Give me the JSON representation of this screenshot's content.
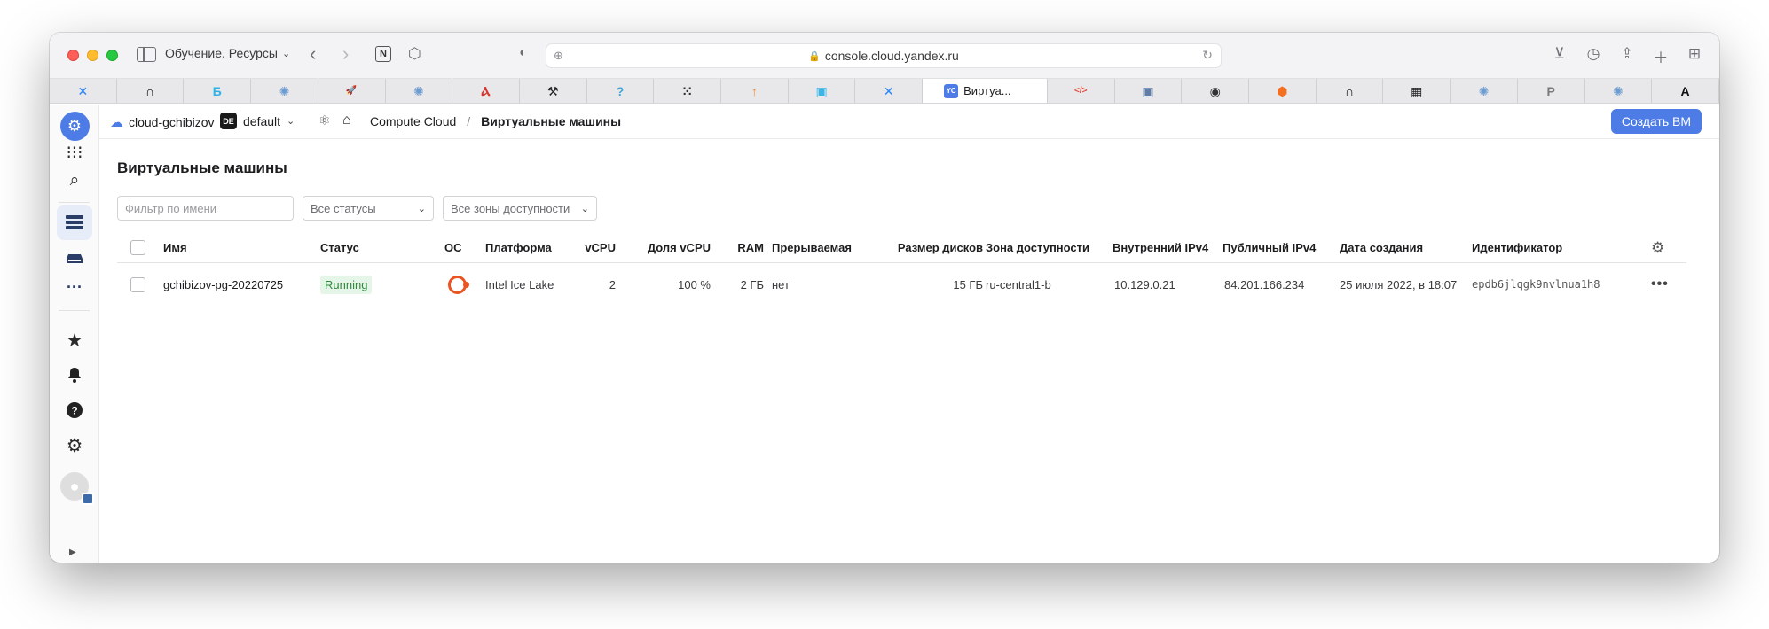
{
  "browser": {
    "tab_group_label": "Обучение. Ресурсы",
    "url": "console.cloud.yandex.ru",
    "active_tab_label": "Виртуа...",
    "active_tab_badge": "YC",
    "tabs": [
      {
        "icon": "confluence-icon",
        "glyph": "✕",
        "color": "#2684ff"
      },
      {
        "icon": "black-square-icon",
        "glyph": "∩",
        "color": "#111111"
      },
      {
        "icon": "gitbook-icon",
        "glyph": "Ƃ",
        "color": "#2cb3e8"
      },
      {
        "icon": "dot-icon",
        "glyph": "✺",
        "color": "#6a9bd1"
      },
      {
        "icon": "rocket-icon",
        "glyph": "🚀",
        "color": "#333333"
      },
      {
        "icon": "dot-icon",
        "glyph": "✺",
        "color": "#6a9bd1"
      },
      {
        "icon": "antenna-icon",
        "glyph": "Ⲁ",
        "color": "#d9342b"
      },
      {
        "icon": "drill-icon",
        "glyph": "⚒",
        "color": "#222222"
      },
      {
        "icon": "question-icon",
        "glyph": "?",
        "color": "#3fa7d6"
      },
      {
        "icon": "grid-dots-icon",
        "glyph": "⁙",
        "color": "#333333"
      },
      {
        "icon": "arrow-up-icon",
        "glyph": "↑",
        "color": "#f28a20"
      },
      {
        "icon": "robot-icon",
        "glyph": "▣",
        "color": "#38b7e8"
      },
      {
        "icon": "confluence-icon",
        "glyph": "✕",
        "color": "#2684ff"
      },
      {
        "icon": "active",
        "glyph": "",
        "color": ""
      },
      {
        "icon": "code-icon",
        "glyph": "</>",
        "color": "#e04a3c"
      },
      {
        "icon": "chip-icon",
        "glyph": "▣",
        "color": "#5f7da6"
      },
      {
        "icon": "disk-icon",
        "glyph": "◉",
        "color": "#333333"
      },
      {
        "icon": "hexagon-icon",
        "glyph": "⬢",
        "color": "#f37021"
      },
      {
        "icon": "black-square-icon",
        "glyph": "∩",
        "color": "#111111"
      },
      {
        "icon": "qr-icon",
        "glyph": "▦",
        "color": "#222222"
      },
      {
        "icon": "dot-icon",
        "glyph": "✺",
        "color": "#6a9bd1"
      },
      {
        "icon": "p-icon",
        "glyph": "P",
        "color": "#7a7a7a"
      },
      {
        "icon": "dot-icon",
        "glyph": "✺",
        "color": "#6a9bd1"
      },
      {
        "icon": "a-circle-icon",
        "glyph": "A",
        "color": "#111111"
      }
    ]
  },
  "header": {
    "cloud": "cloud-gchibizov",
    "folder_badge": "DE",
    "folder": "default",
    "service": "Compute Cloud",
    "separator": "/",
    "current": "Виртуальные машины",
    "create_button": "Создать ВМ"
  },
  "page": {
    "title": "Виртуальные машины",
    "filter_placeholder": "Фильтр по имени",
    "status_filter": "Все статусы",
    "zone_filter": "Все зоны доступности"
  },
  "table": {
    "columns": {
      "name": "Имя",
      "status": "Статус",
      "os": "ОС",
      "platform": "Платформа",
      "vcpu": "vCPU",
      "vcpu_share": "Доля vCPU",
      "ram": "RAM",
      "preemptible": "Прерываемая",
      "disk_size": "Размер дисков",
      "zone": "Зона доступности",
      "internal_ip": "Внутренний IPv4",
      "public_ip": "Публичный IPv4",
      "created": "Дата создания",
      "id": "Идентификатор"
    },
    "rows": [
      {
        "name": "gchibizov-pg-20220725",
        "status": "Running",
        "os": "ubuntu-icon",
        "platform": "Intel Ice Lake",
        "vcpu": "2",
        "vcpu_share": "100 %",
        "ram": "2 ГБ",
        "preemptible": "нет",
        "disk_size": "15 ГБ",
        "zone": "ru-central1-b",
        "internal_ip": "10.129.0.21",
        "public_ip": "84.201.166.234",
        "created": "25 июля 2022, в 18:07",
        "id": "epdb6jlqgk9nvlnua1h8"
      }
    ]
  },
  "colors": {
    "accent": "#4d7ce6",
    "running_bg": "#e5f5e7",
    "running_text": "#2f8a3f",
    "ubuntu": "#e95420"
  }
}
